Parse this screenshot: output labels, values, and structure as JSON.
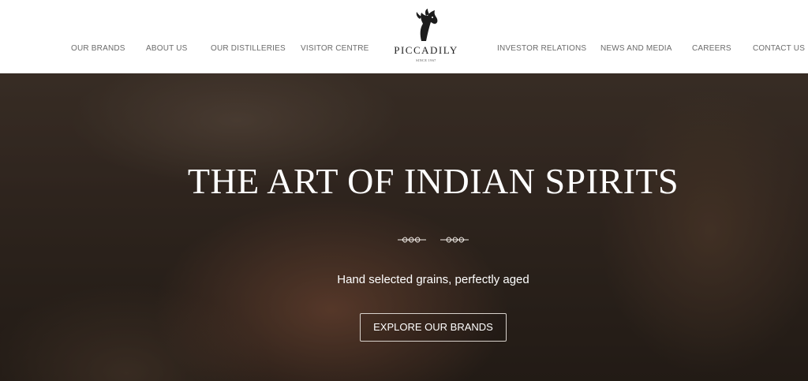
{
  "header": {
    "nav_left": [
      "OUR BRANDS",
      "ABOUT US",
      "OUR DISTILLERIES",
      "VISITOR CENTRE"
    ],
    "nav_right": [
      "INVESTOR RELATIONS",
      "NEWS AND MEDIA",
      "CAREERS",
      "CONTACT US"
    ],
    "logo": {
      "name": "PICCADILY",
      "since": "SINCE 1967",
      "icon": "horse-head-icon"
    }
  },
  "hero": {
    "title": "THE ART OF INDIAN SPIRITS",
    "subtitle": "Hand selected grains, perfectly aged",
    "cta_label": "EXPLORE OUR BRANDS",
    "divider_icon": "wheat-divider-icon"
  },
  "colors": {
    "nav_text": "#6b6b6b",
    "hero_text": "#ffffff",
    "cta_border": "#d8d2cc"
  }
}
